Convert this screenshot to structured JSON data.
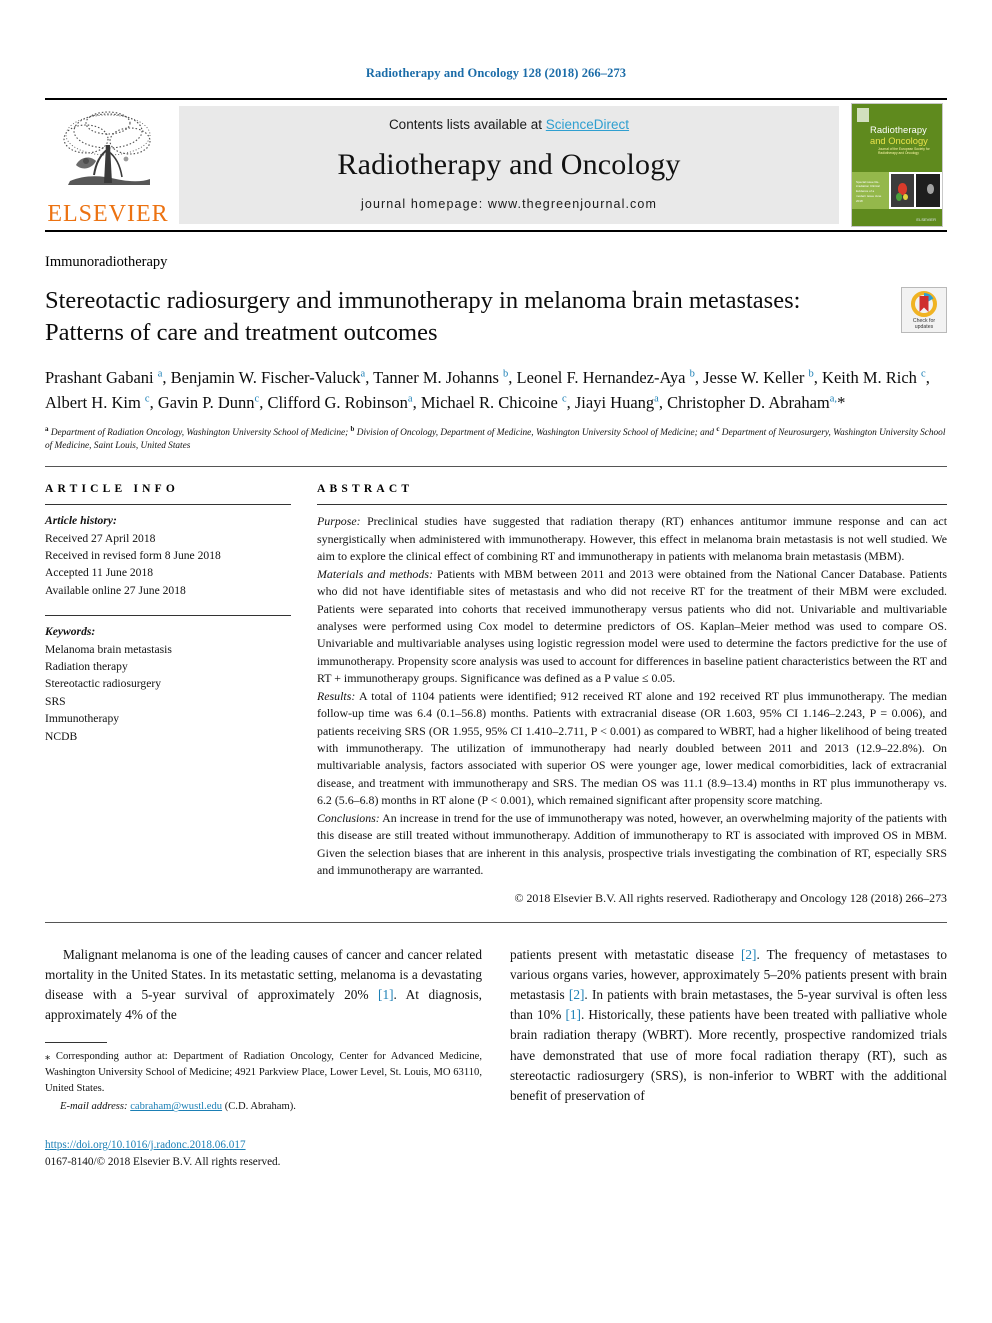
{
  "running_head": "Radiotherapy and Oncology 128 (2018) 266–273",
  "masthead": {
    "publisher_name": "ELSEVIER",
    "contents_prefix": "Contents lists available at ",
    "sciencedirect": "ScienceDirect",
    "journal_name": "Radiotherapy and Oncology",
    "homepage": "journal homepage: www.thegreenjournal.com",
    "cover": {
      "title_line1": "Radiotherapy",
      "title_line2": "and Oncology",
      "subtitle": "Journal of the European Society for Radiotherapy and Oncology",
      "sidebar_text": "Special issue\nRe-irradiation\nClinical Evidence of a modern issue\nJune 2018"
    },
    "colors": {
      "link_blue": "#2f9fd0",
      "elsevier_orange": "#ec7211",
      "panel_grey": "#e9e9e9",
      "cover_green": "#5f8a1e"
    }
  },
  "article": {
    "section_kicker": "Immunoradiotherapy",
    "title": "Stereotactic radiosurgery and immunotherapy in melanoma brain metastases: Patterns of care and treatment outcomes",
    "crossmark": {
      "line1": "Check for",
      "line2": "updates"
    },
    "authors_html": "Prashant Gabani <sup>a</sup>, Benjamin W. Fischer-Valuck<sup>a</sup>, Tanner M. Johanns <sup>b</sup>, Leonel F. Hernandez-Aya <sup>b</sup>, Jesse W. Keller <sup>b</sup>, Keith M. Rich <sup>c</sup>, Albert H. Kim <sup>c</sup>, Gavin P. Dunn<sup>c</sup>, Clifford G. Robinson<sup>a</sup>, Michael R. Chicoine <sup>c</sup>, Jiayi Huang<sup>a</sup>, Christopher D. Abraham<sup>a,</sup>*",
    "affiliations_html": "<sup>a</sup> Department of Radiation Oncology, Washington University School of Medicine; <sup>b</sup> Division of Oncology, Department of Medicine, Washington University School of Medicine; and <sup>c</sup> Department of Neurosurgery, Washington University School of Medicine, Saint Louis, United States"
  },
  "article_info": {
    "heading": "ARTICLE INFO",
    "history_label": "Article history:",
    "history": [
      "Received 27 April 2018",
      "Received in revised form 8 June 2018",
      "Accepted 11 June 2018",
      "Available online 27 June 2018"
    ],
    "keywords_label": "Keywords:",
    "keywords": [
      "Melanoma brain metastasis",
      "Radiation therapy",
      "Stereotactic radiosurgery",
      "SRS",
      "Immunotherapy",
      "NCDB"
    ]
  },
  "abstract": {
    "heading": "ABSTRACT",
    "purpose_label": "Purpose:",
    "purpose_text": " Preclinical studies have suggested that radiation therapy (RT) enhances antitumor immune response and can act synergistically when administered with immunotherapy. However, this effect in melanoma brain metastasis is not well studied. We aim to explore the clinical effect of combining RT and immunotherapy in patients with melanoma brain metastasis (MBM).",
    "methods_label": "Materials and methods:",
    "methods_text": " Patients with MBM between 2011 and 2013 were obtained from the National Cancer Database. Patients who did not have identifiable sites of metastasis and who did not receive RT for the treatment of their MBM were excluded. Patients were separated into cohorts that received immunotherapy versus patients who did not. Univariable and multivariable analyses were performed using Cox model to determine predictors of OS. Kaplan–Meier method was used to compare OS. Univariable and multivariable analyses using logistic regression model were used to determine the factors predictive for the use of immunotherapy. Propensity score analysis was used to account for differences in baseline patient characteristics between the RT and RT + immunotherapy groups. Significance was defined as a P value ≤ 0.05.",
    "results_label": "Results:",
    "results_text": " A total of 1104 patients were identified; 912 received RT alone and 192 received RT plus immunotherapy. The median follow-up time was 6.4 (0.1–56.8) months. Patients with extracranial disease (OR 1.603, 95% CI 1.146–2.243, P = 0.006), and patients receiving SRS (OR 1.955, 95% CI 1.410–2.711, P < 0.001) as compared to WBRT, had a higher likelihood of being treated with immunotherapy. The utilization of immunotherapy had nearly doubled between 2011 and 2013 (12.9–22.8%). On multivariable analysis, factors associated with superior OS were younger age, lower medical comorbidities, lack of extracranial disease, and treatment with immunotherapy and SRS. The median OS was 11.1 (8.9–13.4) months in RT plus immunotherapy vs. 6.2 (5.6–6.8) months in RT alone (P < 0.001), which remained significant after propensity score matching.",
    "conclusions_label": "Conclusions:",
    "conclusions_text": " An increase in trend for the use of immunotherapy was noted, however, an overwhelming majority of the patients with this disease are still treated without immunotherapy. Addition of immunotherapy to RT is associated with improved OS in MBM. Given the selection biases that are inherent in this analysis, prospective trials investigating the combination of RT, especially SRS and immunotherapy are warranted.",
    "copyright": "© 2018 Elsevier B.V. All rights reserved. Radiotherapy and Oncology 128 (2018) 266–273"
  },
  "body": {
    "column_left_html": "Malignant melanoma is one of the leading causes of cancer and cancer related mortality in the United States. In its metastatic setting, melanoma is a devastating disease with a 5-year survival of approximately 20% <span class=\"ref\">[1]</span>. At diagnosis, approximately 4% of the",
    "column_right_html": "patients present with metastatic disease <span class=\"ref\">[2]</span>. The frequency of metastases to various organs varies, however, approximately 5–20% patients present with brain metastasis <span class=\"ref\">[2]</span>. In patients with brain metastases, the 5-year survival is often less than 10% <span class=\"ref\">[1]</span>. Historically, these patients have been treated with palliative whole brain radiation therapy (WBRT). More recently, prospective randomized trials have demonstrated that use of more focal radiation therapy (RT), such as stereotactic radiosurgery (SRS), is non-inferior to WBRT with the additional benefit of preservation of"
  },
  "footnotes": {
    "corresponding_html": "⁎ Corresponding author at: Department of Radiation Oncology, Center for Advanced Medicine, Washington University School of Medicine; 4921 Parkview Place, Lower Level, St. Louis, MO 63110, United States.",
    "email_label": "E-mail address:",
    "email": "cabraham@wustl.edu",
    "email_suffix": " (C.D. Abraham).",
    "doi": "https://doi.org/10.1016/j.radonc.2018.06.017",
    "issn_line": "0167-8140/© 2018 Elsevier B.V. All rights reserved."
  }
}
